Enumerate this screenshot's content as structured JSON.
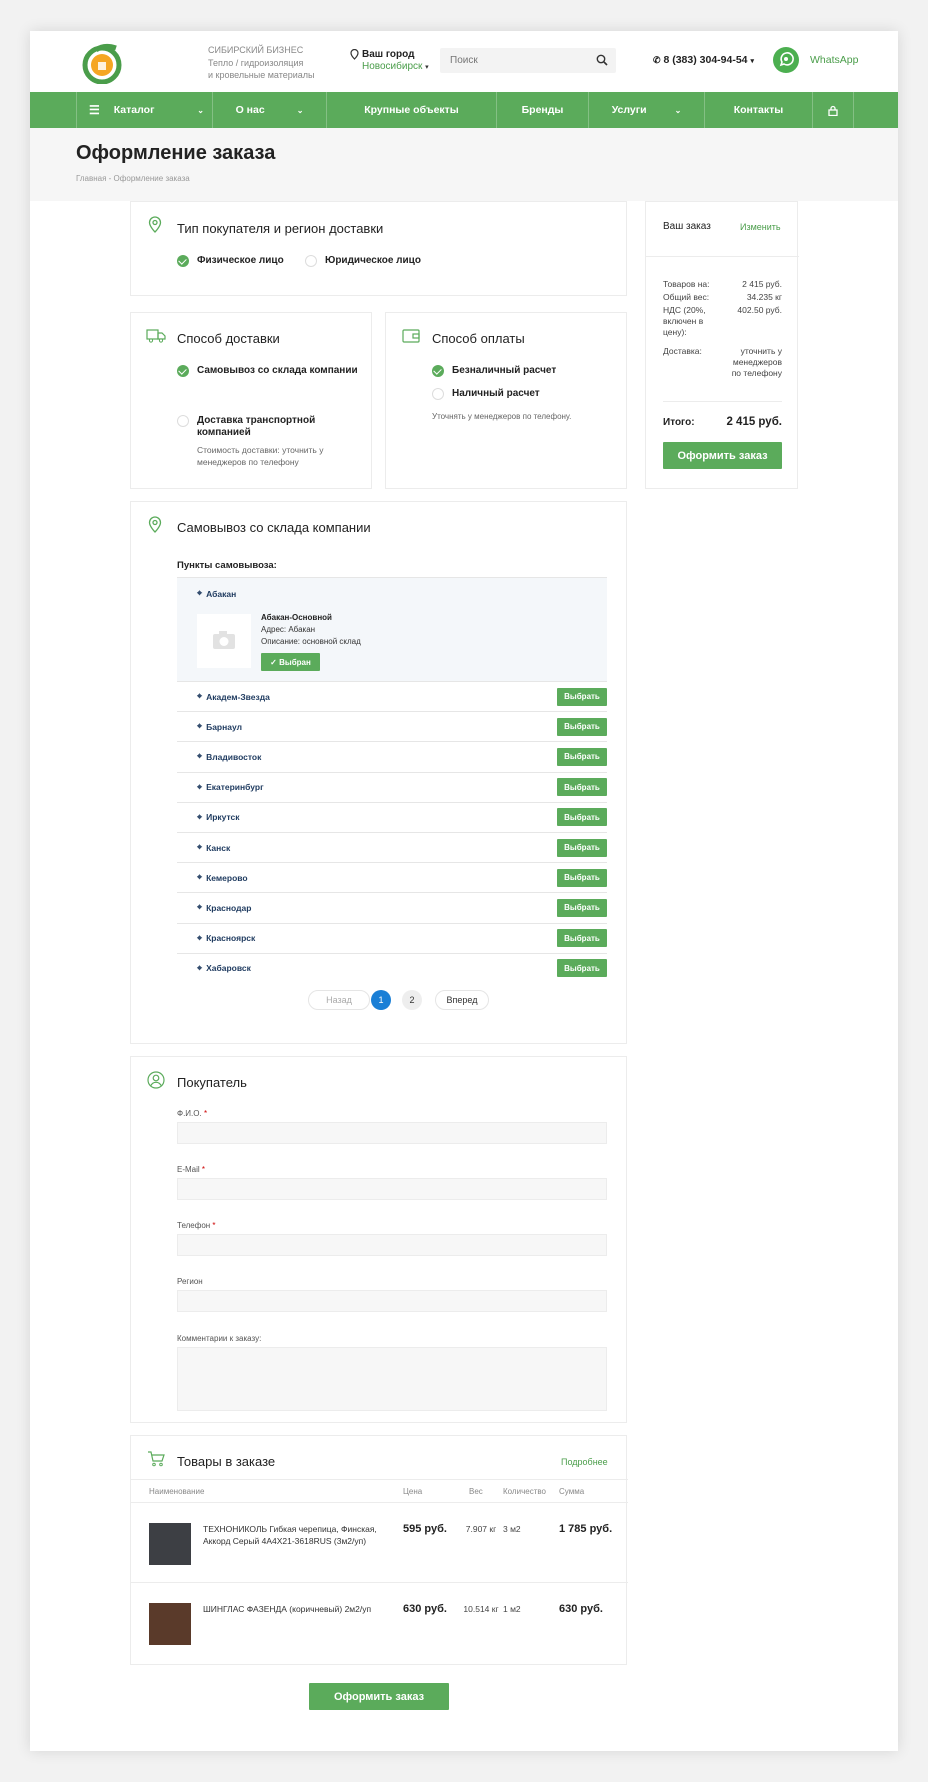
{
  "header": {
    "tagline": [
      "СИБИРСКИЙ БИЗНЕС",
      "Тепло / гидроизоляция",
      "и кровельные материалы"
    ],
    "city_title": "Ваш город",
    "city_name": "Новосибирск",
    "search_placeholder": "Поиск",
    "phone": "8 (383) 304-94-54",
    "whatsapp": "WhatsApp"
  },
  "nav": {
    "items": [
      {
        "label": "Каталог"
      },
      {
        "label": "О нас"
      },
      {
        "label": "Крупные объекты"
      },
      {
        "label": "Бренды"
      },
      {
        "label": "Услуги"
      },
      {
        "label": "Контакты"
      }
    ]
  },
  "page": {
    "title": "Оформление заказа",
    "breadcrumb": "Главная  -  Оформление заказа"
  },
  "buyer_type": {
    "title": "Тип покупателя и регион доставки",
    "options": [
      "Физическое лицо",
      "Юридическое лицо"
    ],
    "selected": 0
  },
  "delivery": {
    "title": "Способ доставки",
    "options": [
      "Самовывоз со склада компании",
      "Доставка транспортной компанией"
    ],
    "note": "Стоимость доставки: уточнить у менеджеров по телефону",
    "selected": 0
  },
  "payment": {
    "title": "Способ оплаты",
    "options": [
      "Безналичный расчет",
      "Наличный расчет"
    ],
    "note": "Уточнять у менеджеров по телефону.",
    "selected": 0
  },
  "pickup": {
    "title": "Самовывоз со склада компании",
    "subtitle": "Пункты самовывоза:",
    "selected_city": "Абакан",
    "selected_name": "Абакан-Основной",
    "selected_address": "Адрес: Абакан",
    "selected_desc": "Описание: основной склад",
    "selected_btn": "Выбран",
    "choose_label": "Выбрать",
    "points": [
      "Академ-Звезда",
      "Барнаул",
      "Владивосток",
      "Екатеринбург",
      "Иркутск",
      "Канск",
      "Кемерово",
      "Краснодар",
      "Красноярск",
      "Хабаровск"
    ],
    "pager": {
      "prev": "Назад",
      "pages": [
        "1",
        "2"
      ],
      "current": "1",
      "next": "Вперед"
    }
  },
  "customer": {
    "title": "Покупатель",
    "fields": [
      {
        "label": "Ф.И.О.",
        "required": true
      },
      {
        "label": "E-Mail",
        "required": true
      },
      {
        "label": "Телефон",
        "required": true
      },
      {
        "label": "Регион",
        "required": false
      },
      {
        "label": "Комментарии к заказу:",
        "required": false
      }
    ]
  },
  "goods": {
    "title": "Товары в заказе",
    "more": "Подробнее",
    "headers": [
      "Наименование",
      "Цена",
      "Вес",
      "Количество",
      "Сумма"
    ],
    "rows": [
      {
        "name": "ТЕХНОНИКОЛЬ Гибкая черепица, Финская, Аккорд Серый 4А4Х21-3618RUS (3м2/уп)",
        "price": "595 руб.",
        "weight": "7.907 кг",
        "qty": "3 м2",
        "sum": "1 785 руб.",
        "thumb_color": "#3d3f44"
      },
      {
        "name": "ШИНГЛАС ФАЗЕНДА (коричневый) 2м2/уп",
        "price": "630 руб.",
        "weight": "10.514 кг",
        "qty": "1 м2",
        "sum": "630 руб.",
        "thumb_color": "#5a3a2a"
      }
    ]
  },
  "submit_label": "Оформить заказ",
  "summary": {
    "title": "Ваш заказ",
    "edit": "Изменить",
    "rows": [
      {
        "k": "Товаров на:",
        "v": "2 415 руб."
      },
      {
        "k": "Общий вес:",
        "v": "34.235 кг"
      },
      {
        "k": "НДС (20%, включен в цену):",
        "v": "402.50 руб."
      },
      {
        "k": "Доставка:",
        "v": "уточнить у менеджеров по телефону"
      }
    ],
    "total_label": "Итого:",
    "total_value": "2 415 руб.",
    "button": "Оформить заказ"
  },
  "colors": {
    "accent": "#5bab5b",
    "link": "#4a9d4a"
  }
}
